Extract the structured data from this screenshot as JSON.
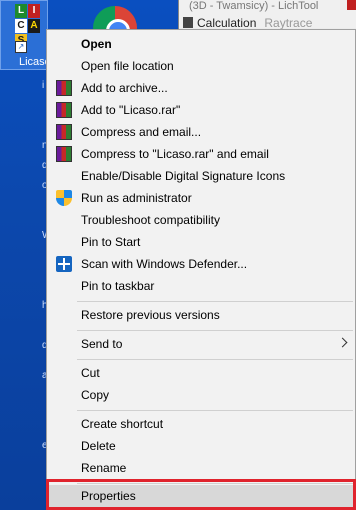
{
  "desktop": {
    "icon_label": "Licaso",
    "tiles": [
      "L",
      "I",
      "C",
      "A",
      "S",
      "O"
    ],
    "left_strip": [
      "i",
      "n",
      "d",
      "o",
      "W",
      "h",
      "d",
      "a",
      "e"
    ]
  },
  "background_window": {
    "title": "(3D - Twamsicy) - LichTool",
    "toolbar_calc": "Calculation",
    "toolbar_ray": "Raytrace"
  },
  "context_menu": {
    "items": [
      {
        "label": "Open",
        "bold": true,
        "icon": ""
      },
      {
        "label": "Open file location",
        "icon": ""
      },
      {
        "label": "Add to archive...",
        "icon": "winrar-icon"
      },
      {
        "label": "Add to \"Licaso.rar\"",
        "icon": "winrar-icon"
      },
      {
        "label": "Compress and email...",
        "icon": "winrar-icon"
      },
      {
        "label": "Compress to \"Licaso.rar\" and email",
        "icon": "winrar-icon"
      },
      {
        "label": "Enable/Disable Digital Signature Icons",
        "icon": ""
      },
      {
        "label": "Run as administrator",
        "icon": "uac-shield-icon"
      },
      {
        "label": "Troubleshoot compatibility",
        "icon": ""
      },
      {
        "label": "Pin to Start",
        "icon": ""
      },
      {
        "label": "Scan with Windows Defender...",
        "icon": "windows-defender-icon"
      },
      {
        "label": "Pin to taskbar",
        "icon": ""
      },
      {
        "label": "Restore previous versions",
        "icon": ""
      },
      {
        "label": "Send to",
        "icon": "",
        "submenu": true
      },
      {
        "label": "Cut",
        "icon": ""
      },
      {
        "label": "Copy",
        "icon": ""
      },
      {
        "label": "Create shortcut",
        "icon": ""
      },
      {
        "label": "Delete",
        "icon": ""
      },
      {
        "label": "Rename",
        "icon": ""
      },
      {
        "label": "Properties",
        "icon": "",
        "highlighted": true
      }
    ]
  },
  "colors": {
    "desktop": "#0c48ad",
    "menu_bg": "#f2f2f2",
    "highlight_frame": "#e0232d"
  }
}
